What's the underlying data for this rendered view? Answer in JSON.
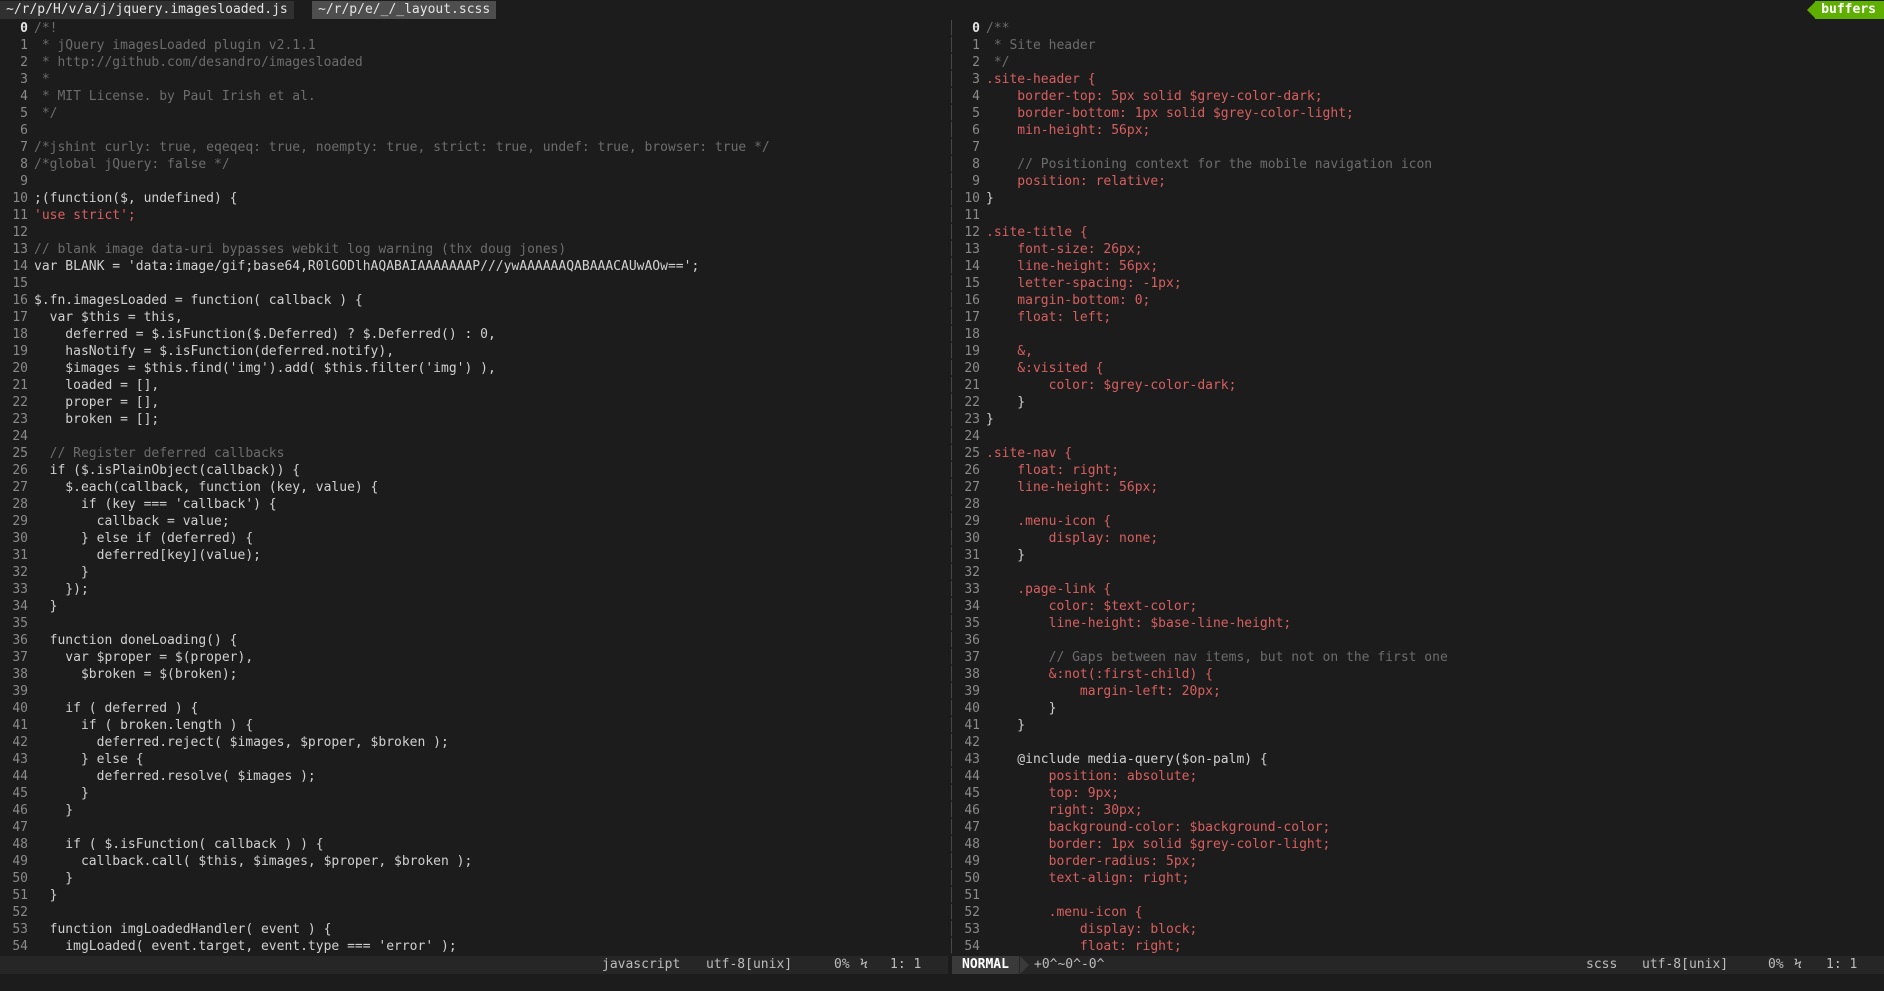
{
  "tabs": {
    "left_tab": "~/r/p/H/v/a/j/jquery.imagesloaded.js",
    "right_tab": "~/r/p/e/_/_layout.scss",
    "buffers_label": "buffers"
  },
  "left_pane": {
    "lines": [
      {
        "n": "0",
        "t": "/*!",
        "c": "com"
      },
      {
        "n": "1",
        "t": " * jQuery imagesLoaded plugin v2.1.1",
        "c": "com"
      },
      {
        "n": "2",
        "t": " * http://github.com/desandro/imagesloaded",
        "c": "com"
      },
      {
        "n": "3",
        "t": " *",
        "c": "com"
      },
      {
        "n": "4",
        "t": " * MIT License. by Paul Irish et al.",
        "c": "com"
      },
      {
        "n": "5",
        "t": " */",
        "c": "com"
      },
      {
        "n": "6",
        "t": "",
        "c": "def"
      },
      {
        "n": "7",
        "t": "/*jshint curly: true, eqeqeq: true, noempty: true, strict: true, undef: true, browser: true */",
        "c": "com"
      },
      {
        "n": "8",
        "t": "/*global jQuery: false */",
        "c": "com"
      },
      {
        "n": "9",
        "t": "",
        "c": "def"
      },
      {
        "n": "10",
        "t": ";(function($, undefined) {",
        "c": "def"
      },
      {
        "n": "11",
        "t": "'use strict';",
        "c": "str"
      },
      {
        "n": "12",
        "t": "",
        "c": "def"
      },
      {
        "n": "13",
        "t": "// blank image data-uri bypasses webkit log warning (thx doug jones)",
        "c": "com"
      },
      {
        "n": "14",
        "t": "var BLANK = 'data:image/gif;base64,R0lGODlhAQABAIAAAAAAAP///ywAAAAAAQABAAACAUwAOw==';",
        "c": "def"
      },
      {
        "n": "15",
        "t": "",
        "c": "def"
      },
      {
        "n": "16",
        "t": "$.fn.imagesLoaded = function( callback ) {",
        "c": "def"
      },
      {
        "n": "17",
        "t": "  var $this = this,",
        "c": "def"
      },
      {
        "n": "18",
        "t": "    deferred = $.isFunction($.Deferred) ? $.Deferred() : 0,",
        "c": "def"
      },
      {
        "n": "19",
        "t": "    hasNotify = $.isFunction(deferred.notify),",
        "c": "def"
      },
      {
        "n": "20",
        "t": "    $images = $this.find('img').add( $this.filter('img') ),",
        "c": "def"
      },
      {
        "n": "21",
        "t": "    loaded = [],",
        "c": "def"
      },
      {
        "n": "22",
        "t": "    proper = [],",
        "c": "def"
      },
      {
        "n": "23",
        "t": "    broken = [];",
        "c": "def"
      },
      {
        "n": "24",
        "t": "",
        "c": "def"
      },
      {
        "n": "25",
        "t": "  // Register deferred callbacks",
        "c": "com"
      },
      {
        "n": "26",
        "t": "  if ($.isPlainObject(callback)) {",
        "c": "def"
      },
      {
        "n": "27",
        "t": "    $.each(callback, function (key, value) {",
        "c": "def"
      },
      {
        "n": "28",
        "t": "      if (key === 'callback') {",
        "c": "def"
      },
      {
        "n": "29",
        "t": "        callback = value;",
        "c": "def"
      },
      {
        "n": "30",
        "t": "      } else if (deferred) {",
        "c": "def"
      },
      {
        "n": "31",
        "t": "        deferred[key](value);",
        "c": "def"
      },
      {
        "n": "32",
        "t": "      }",
        "c": "def"
      },
      {
        "n": "33",
        "t": "    });",
        "c": "def"
      },
      {
        "n": "34",
        "t": "  }",
        "c": "def"
      },
      {
        "n": "35",
        "t": "",
        "c": "def"
      },
      {
        "n": "36",
        "t": "  function doneLoading() {",
        "c": "def"
      },
      {
        "n": "37",
        "t": "    var $proper = $(proper),",
        "c": "def"
      },
      {
        "n": "38",
        "t": "      $broken = $(broken);",
        "c": "def"
      },
      {
        "n": "39",
        "t": "",
        "c": "def"
      },
      {
        "n": "40",
        "t": "    if ( deferred ) {",
        "c": "def"
      },
      {
        "n": "41",
        "t": "      if ( broken.length ) {",
        "c": "def"
      },
      {
        "n": "42",
        "t": "        deferred.reject( $images, $proper, $broken );",
        "c": "def"
      },
      {
        "n": "43",
        "t": "      } else {",
        "c": "def"
      },
      {
        "n": "44",
        "t": "        deferred.resolve( $images );",
        "c": "def"
      },
      {
        "n": "45",
        "t": "      }",
        "c": "def"
      },
      {
        "n": "46",
        "t": "    }",
        "c": "def"
      },
      {
        "n": "47",
        "t": "",
        "c": "def"
      },
      {
        "n": "48",
        "t": "    if ( $.isFunction( callback ) ) {",
        "c": "def"
      },
      {
        "n": "49",
        "t": "      callback.call( $this, $images, $proper, $broken );",
        "c": "def"
      },
      {
        "n": "50",
        "t": "    }",
        "c": "def"
      },
      {
        "n": "51",
        "t": "  }",
        "c": "def"
      },
      {
        "n": "52",
        "t": "",
        "c": "def"
      },
      {
        "n": "53",
        "t": "  function imgLoadedHandler( event ) {",
        "c": "def"
      },
      {
        "n": "54",
        "t": "    imgLoaded( event.target, event.type === 'error' );",
        "c": "def"
      }
    ],
    "status": {
      "filetype": "javascript",
      "encoding": "utf-8[unix]",
      "percent": "0%",
      "pos_glyph": "Ϟ",
      "position": "1:  1"
    }
  },
  "right_pane": {
    "lines": [
      {
        "n": "0",
        "t": "/**",
        "c": "com"
      },
      {
        "n": "1",
        "t": " * Site header",
        "c": "com"
      },
      {
        "n": "2",
        "t": " */",
        "c": "com"
      },
      {
        "n": "3",
        "t": ".site-header {",
        "c": "sel"
      },
      {
        "n": "4",
        "t": "    border-top: 5px solid $grey-color-dark;",
        "c": "prop"
      },
      {
        "n": "5",
        "t": "    border-bottom: 1px solid $grey-color-light;",
        "c": "prop"
      },
      {
        "n": "6",
        "t": "    min-height: 56px;",
        "c": "prop"
      },
      {
        "n": "7",
        "t": "",
        "c": "def"
      },
      {
        "n": "8",
        "t": "    // Positioning context for the mobile navigation icon",
        "c": "com"
      },
      {
        "n": "9",
        "t": "    position: relative;",
        "c": "prop"
      },
      {
        "n": "10",
        "t": "}",
        "c": "def"
      },
      {
        "n": "11",
        "t": "",
        "c": "def"
      },
      {
        "n": "12",
        "t": ".site-title {",
        "c": "sel"
      },
      {
        "n": "13",
        "t": "    font-size: 26px;",
        "c": "prop"
      },
      {
        "n": "14",
        "t": "    line-height: 56px;",
        "c": "prop"
      },
      {
        "n": "15",
        "t": "    letter-spacing: -1px;",
        "c": "prop"
      },
      {
        "n": "16",
        "t": "    margin-bottom: 0;",
        "c": "prop"
      },
      {
        "n": "17",
        "t": "    float: left;",
        "c": "prop"
      },
      {
        "n": "18",
        "t": "",
        "c": "def"
      },
      {
        "n": "19",
        "t": "    &,",
        "c": "sel"
      },
      {
        "n": "20",
        "t": "    &:visited {",
        "c": "sel"
      },
      {
        "n": "21",
        "t": "        color: $grey-color-dark;",
        "c": "prop"
      },
      {
        "n": "22",
        "t": "    }",
        "c": "def"
      },
      {
        "n": "23",
        "t": "}",
        "c": "def"
      },
      {
        "n": "24",
        "t": "",
        "c": "def"
      },
      {
        "n": "25",
        "t": ".site-nav {",
        "c": "sel"
      },
      {
        "n": "26",
        "t": "    float: right;",
        "c": "prop"
      },
      {
        "n": "27",
        "t": "    line-height: 56px;",
        "c": "prop"
      },
      {
        "n": "28",
        "t": "",
        "c": "def"
      },
      {
        "n": "29",
        "t": "    .menu-icon {",
        "c": "sel"
      },
      {
        "n": "30",
        "t": "        display: none;",
        "c": "prop"
      },
      {
        "n": "31",
        "t": "    }",
        "c": "def"
      },
      {
        "n": "32",
        "t": "",
        "c": "def"
      },
      {
        "n": "33",
        "t": "    .page-link {",
        "c": "sel"
      },
      {
        "n": "34",
        "t": "        color: $text-color;",
        "c": "prop"
      },
      {
        "n": "35",
        "t": "        line-height: $base-line-height;",
        "c": "prop"
      },
      {
        "n": "36",
        "t": "",
        "c": "def"
      },
      {
        "n": "37",
        "t": "        // Gaps between nav items, but not on the first one",
        "c": "com"
      },
      {
        "n": "38",
        "t": "        &:not(:first-child) {",
        "c": "sel"
      },
      {
        "n": "39",
        "t": "            margin-left: 20px;",
        "c": "prop"
      },
      {
        "n": "40",
        "t": "        }",
        "c": "def"
      },
      {
        "n": "41",
        "t": "    }",
        "c": "def"
      },
      {
        "n": "42",
        "t": "",
        "c": "def"
      },
      {
        "n": "43",
        "t": "    @include media-query($on-palm) {",
        "c": "def"
      },
      {
        "n": "44",
        "t": "        position: absolute;",
        "c": "prop"
      },
      {
        "n": "45",
        "t": "        top: 9px;",
        "c": "prop"
      },
      {
        "n": "46",
        "t": "        right: 30px;",
        "c": "prop"
      },
      {
        "n": "47",
        "t": "        background-color: $background-color;",
        "c": "prop"
      },
      {
        "n": "48",
        "t": "        border: 1px solid $grey-color-light;",
        "c": "prop"
      },
      {
        "n": "49",
        "t": "        border-radius: 5px;",
        "c": "prop"
      },
      {
        "n": "50",
        "t": "        text-align: right;",
        "c": "prop"
      },
      {
        "n": "51",
        "t": "",
        "c": "def"
      },
      {
        "n": "52",
        "t": "        .menu-icon {",
        "c": "sel"
      },
      {
        "n": "53",
        "t": "            display: block;",
        "c": "prop"
      },
      {
        "n": "54",
        "t": "            float: right;",
        "c": "prop"
      }
    ],
    "status": {
      "mode": "NORMAL",
      "branch": "+0^~0^-0^",
      "filetype": "scss",
      "encoding": "utf-8[unix]",
      "percent": "0%",
      "pos_glyph": "Ϟ",
      "position": "1:  1"
    }
  },
  "colors": {
    "background": "#1c1c1c",
    "accent_green": "#5faf00",
    "keyword_red": "#d75f5f",
    "comment_grey": "#6c6c6c"
  }
}
